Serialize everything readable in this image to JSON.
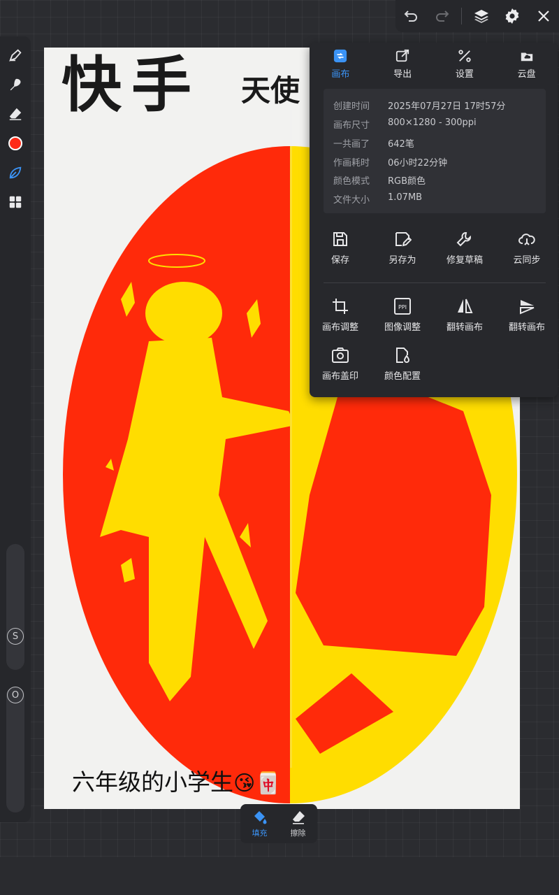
{
  "topbar": {
    "icons": [
      "undo-icon",
      "redo-icon",
      "layers-icon",
      "settings-icon",
      "close-icon"
    ]
  },
  "left_toolbar": {
    "tools": [
      "brush-icon",
      "smudge-icon",
      "eraser-icon",
      "color-picker",
      "brush-shape-icon",
      "grid-icon"
    ],
    "active_color": "#ff2a17",
    "size_slider_label": "S",
    "opacity_slider_label": "O"
  },
  "canvas": {
    "title_big": "快手",
    "title_small": "天使",
    "caption": "六年级的小学生",
    "caption_emojis": [
      "😘",
      "🀄"
    ],
    "colors": {
      "red": "#ff2a0a",
      "yellow": "#ffdd00",
      "paper": "#f2f2f0"
    }
  },
  "panel": {
    "tabs": [
      {
        "label": "画布",
        "icon": "canvas-icon",
        "active": true
      },
      {
        "label": "导出",
        "icon": "export-icon",
        "active": false
      },
      {
        "label": "设置",
        "icon": "tools-icon",
        "active": false
      },
      {
        "label": "云盘",
        "icon": "cloud-drive-icon",
        "active": false
      }
    ],
    "info": [
      {
        "key": "创建时间",
        "value": "2025年07月27日 17时57分"
      },
      {
        "key": "画布尺寸",
        "value": "800×1280 - 300ppi"
      },
      {
        "key": "一共画了",
        "value": "642笔"
      },
      {
        "key": "作画耗时",
        "value": "06小时22分钟"
      },
      {
        "key": "颜色模式",
        "value": "RGB颜色"
      },
      {
        "key": "文件大小",
        "value": "1.07MB"
      }
    ],
    "actions_row1": [
      {
        "label": "保存",
        "icon": "save-icon"
      },
      {
        "label": "另存为",
        "icon": "save-as-icon"
      },
      {
        "label": "修复草稿",
        "icon": "repair-icon"
      },
      {
        "label": "云同步",
        "icon": "cloud-sync-icon"
      }
    ],
    "actions_row2": [
      {
        "label": "画布调整",
        "icon": "crop-icon"
      },
      {
        "label": "图像调整",
        "icon": "ppi-icon"
      },
      {
        "label": "翻转画布",
        "icon": "flip-horizontal-icon"
      },
      {
        "label": "翻转画布",
        "icon": "flip-vertical-icon"
      }
    ],
    "actions_row3": [
      {
        "label": "画布盖印",
        "icon": "camera-icon"
      },
      {
        "label": "颜色配置",
        "icon": "color-profile-icon"
      }
    ]
  },
  "fill_bar": {
    "fill_label": "填充",
    "erase_label": "擦除"
  },
  "accent_color": "#3b93f5"
}
